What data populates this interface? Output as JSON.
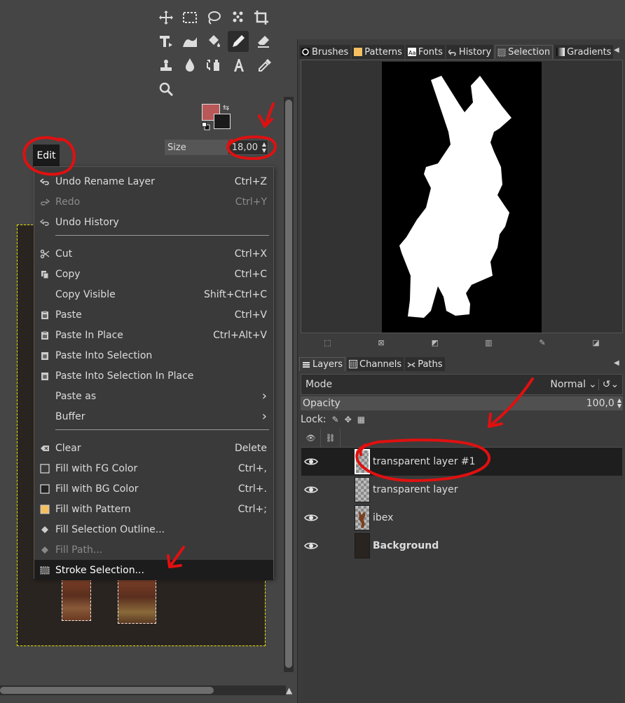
{
  "toolbox": {
    "tools": [
      {
        "name": "move-tool-icon",
        "active": false
      },
      {
        "name": "rect-select-tool-icon",
        "active": false
      },
      {
        "name": "lasso-tool-icon",
        "active": false
      },
      {
        "name": "fuzzy-select-tool-icon",
        "active": false
      },
      {
        "name": "crop-tool-icon",
        "active": false
      },
      {
        "name": "transform-tool-icon",
        "active": false
      },
      {
        "name": "warp-tool-icon",
        "active": false
      },
      {
        "name": "bucket-fill-tool-icon",
        "active": false
      },
      {
        "name": "pencil-tool-icon",
        "active": true
      },
      {
        "name": "eraser-tool-icon",
        "active": false
      },
      {
        "name": "clone-tool-icon",
        "active": false
      },
      {
        "name": "smudge-tool-icon",
        "active": false
      },
      {
        "name": "paths-tool-icon",
        "active": false
      },
      {
        "name": "text-tool-icon",
        "active": false
      },
      {
        "name": "color-picker-tool-icon",
        "active": false
      },
      {
        "name": "zoom-tool-icon",
        "active": false
      }
    ],
    "fg_color": "#b85858",
    "bg_color": "#1a1a1a",
    "size_label": "Size",
    "size_value": "18,00"
  },
  "edit_menu": {
    "title": "Edit",
    "items": [
      {
        "label": "Undo Rename Layer",
        "shortcut": "Ctrl+Z",
        "icon": "undo-icon",
        "disabled": false
      },
      {
        "label": "Redo",
        "shortcut": "Ctrl+Y",
        "icon": "redo-icon",
        "disabled": true
      },
      {
        "label": "Undo History",
        "shortcut": "",
        "icon": "history-icon",
        "disabled": false
      },
      {
        "label": "Cut",
        "shortcut": "Ctrl+X",
        "icon": "scissors-icon",
        "disabled": false
      },
      {
        "label": "Copy",
        "shortcut": "Ctrl+C",
        "icon": "copy-icon",
        "disabled": false
      },
      {
        "label": "Copy Visible",
        "shortcut": "Shift+Ctrl+C",
        "icon": "",
        "disabled": false
      },
      {
        "label": "Paste",
        "shortcut": "Ctrl+V",
        "icon": "paste-icon",
        "disabled": false
      },
      {
        "label": "Paste In Place",
        "shortcut": "Ctrl+Alt+V",
        "icon": "paste-icon",
        "disabled": false
      },
      {
        "label": "Paste Into Selection",
        "shortcut": "",
        "icon": "paste-into-icon",
        "disabled": false
      },
      {
        "label": "Paste Into Selection In Place",
        "shortcut": "",
        "icon": "paste-into-icon",
        "disabled": false
      },
      {
        "label": "Paste as",
        "shortcut": "›",
        "icon": "",
        "disabled": false
      },
      {
        "label": "Buffer",
        "shortcut": "›",
        "icon": "",
        "disabled": false
      },
      {
        "label": "Clear",
        "shortcut": "Delete",
        "icon": "clear-icon",
        "disabled": false
      },
      {
        "label": "Fill with FG Color",
        "shortcut": "Ctrl+,",
        "icon": "fg-fill-icon",
        "disabled": false
      },
      {
        "label": "Fill with BG Color",
        "shortcut": "Ctrl+.",
        "icon": "bg-fill-icon",
        "disabled": false
      },
      {
        "label": "Fill with Pattern",
        "shortcut": "Ctrl+;",
        "icon": "pattern-fill-icon",
        "disabled": false
      },
      {
        "label": "Fill Selection Outline...",
        "shortcut": "",
        "icon": "fill-outline-icon",
        "disabled": false
      },
      {
        "label": "Fill Path...",
        "shortcut": "",
        "icon": "fill-path-icon",
        "disabled": true
      },
      {
        "label": "Stroke Selection...",
        "shortcut": "",
        "icon": "stroke-selection-icon",
        "disabled": false,
        "highlighted": true
      }
    ]
  },
  "top_dock": {
    "tabs": [
      {
        "label": "Brushes",
        "icon": "brushes-icon",
        "color": "#ffffff"
      },
      {
        "label": "Patterns",
        "icon": "patterns-icon",
        "color": "#f4c060"
      },
      {
        "label": "Fonts",
        "icon": "fonts-icon",
        "color": "#ffffff"
      },
      {
        "label": "History",
        "icon": "history-icon",
        "color": "#ffffff"
      },
      {
        "label": "Selection",
        "icon": "selection-icon",
        "color": "#888888"
      },
      {
        "label": "Gradients",
        "icon": "gradients-icon",
        "color": "#888888"
      }
    ],
    "selected_tab": "Selection"
  },
  "layers_dock": {
    "tabs": [
      {
        "label": "Layers",
        "icon": "layers-icon"
      },
      {
        "label": "Channels",
        "icon": "channels-icon"
      },
      {
        "label": "Paths",
        "icon": "paths-icon"
      }
    ],
    "mode_label": "Mode",
    "mode_value": "Normal",
    "opacity_label": "Opacity",
    "opacity_value": "100,0",
    "lock_label": "Lock:",
    "layers": [
      {
        "name": "transparent layer #1",
        "thumb": "checker",
        "bold": false,
        "selected": true
      },
      {
        "name": "transparent layer",
        "thumb": "checker",
        "bold": false,
        "selected": false
      },
      {
        "name": "ibex",
        "thumb": "ibex",
        "bold": false,
        "selected": false
      },
      {
        "name": "Background",
        "thumb": "dark",
        "bold": true,
        "selected": false
      }
    ]
  }
}
